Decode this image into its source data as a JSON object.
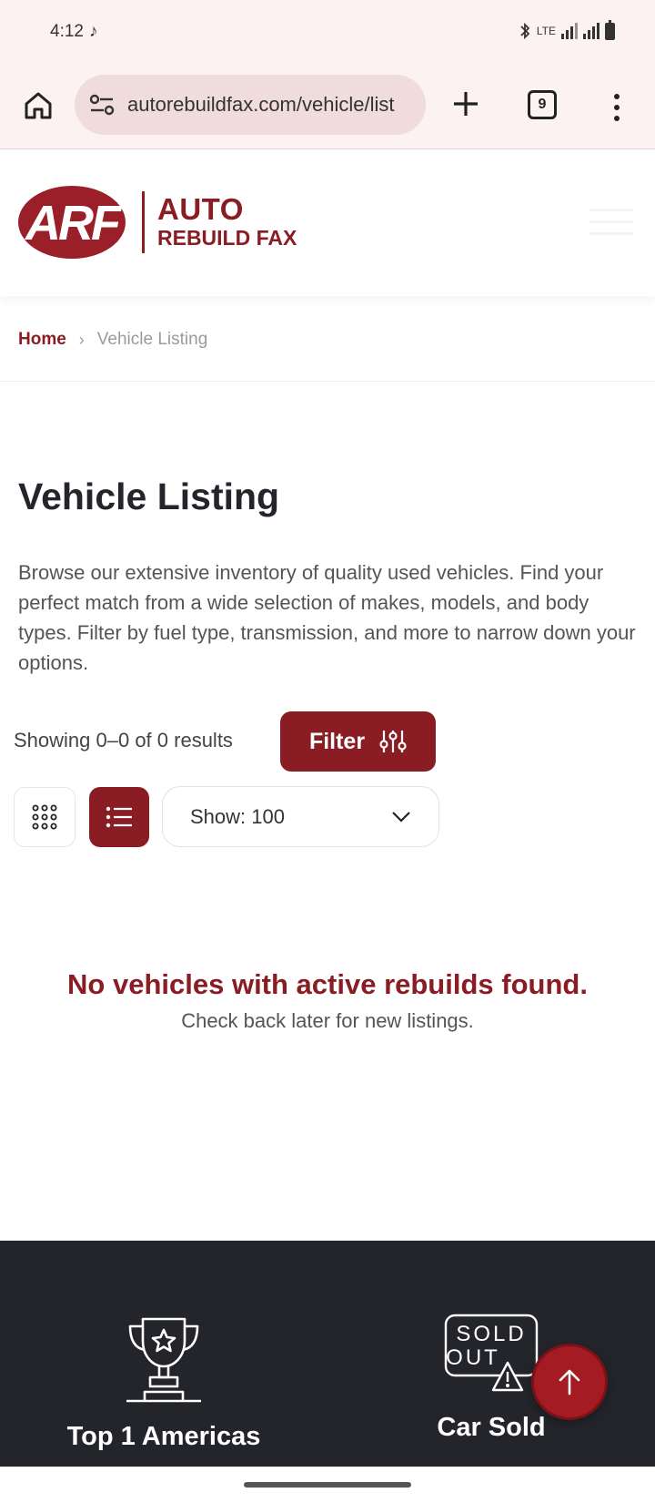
{
  "status_bar": {
    "time": "4:12",
    "tiktok_icon": "♪",
    "network": "LTE"
  },
  "browser": {
    "url": "autorebuildfax.com/vehicle/list",
    "tab_count": "9"
  },
  "header": {
    "logo_mark": "ARF",
    "logo_auto": "AUTO",
    "logo_rebuild": "REBUILD FAX"
  },
  "breadcrumb": {
    "home": "Home",
    "separator": "›",
    "current": "Vehicle Listing"
  },
  "main": {
    "title": "Vehicle Listing",
    "description": "Browse our extensive inventory of quality used vehicles. Find your perfect match from a wide selection of makes, models, and body types. Filter by fuel type, transmission, and more to narrow down your options.",
    "results": "Showing 0–0 of 0 results",
    "filter_label": "Filter",
    "show_select": "Show: 100",
    "empty_title": "No vehicles with active rebuilds found.",
    "empty_subtitle": "Check back later for new listings."
  },
  "footer": {
    "stats": [
      {
        "label": "Top 1 Americas",
        "icon": "trophy-icon"
      },
      {
        "label": "Car Sold",
        "icon": "sold-out-icon",
        "icon_text_1": "SOLD",
        "icon_text_2": "OUT"
      }
    ]
  },
  "colors": {
    "brand": "#8a1c24",
    "footer_bg": "#23252b",
    "browser_bg": "#fcf2f2"
  }
}
